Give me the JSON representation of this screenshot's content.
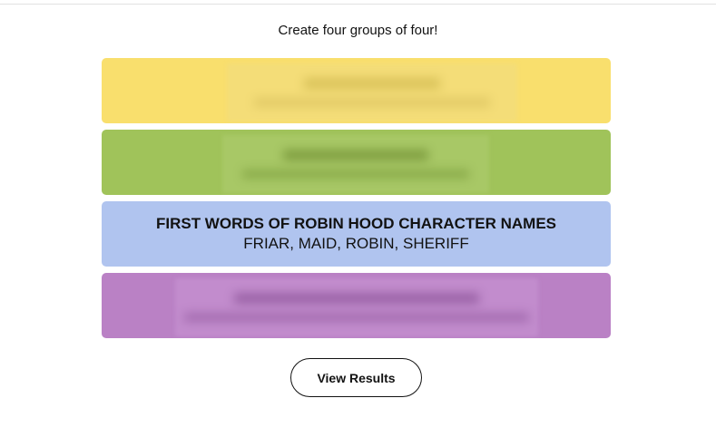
{
  "header": {
    "instructions": "Create four groups of four!"
  },
  "groups": [
    {
      "color": "#f9df6d",
      "blurred": true,
      "title": "",
      "members": ""
    },
    {
      "color": "#a0c35a",
      "blurred": true,
      "title": "",
      "members": ""
    },
    {
      "color": "#b0c4ef",
      "blurred": false,
      "title": "FIRST WORDS OF ROBIN HOOD CHARACTER NAMES",
      "members": "FRIAR, MAID, ROBIN, SHERIFF"
    },
    {
      "color": "#ba81c5",
      "blurred": true,
      "title": "",
      "members": ""
    }
  ],
  "actions": {
    "view_results_label": "View Results"
  }
}
